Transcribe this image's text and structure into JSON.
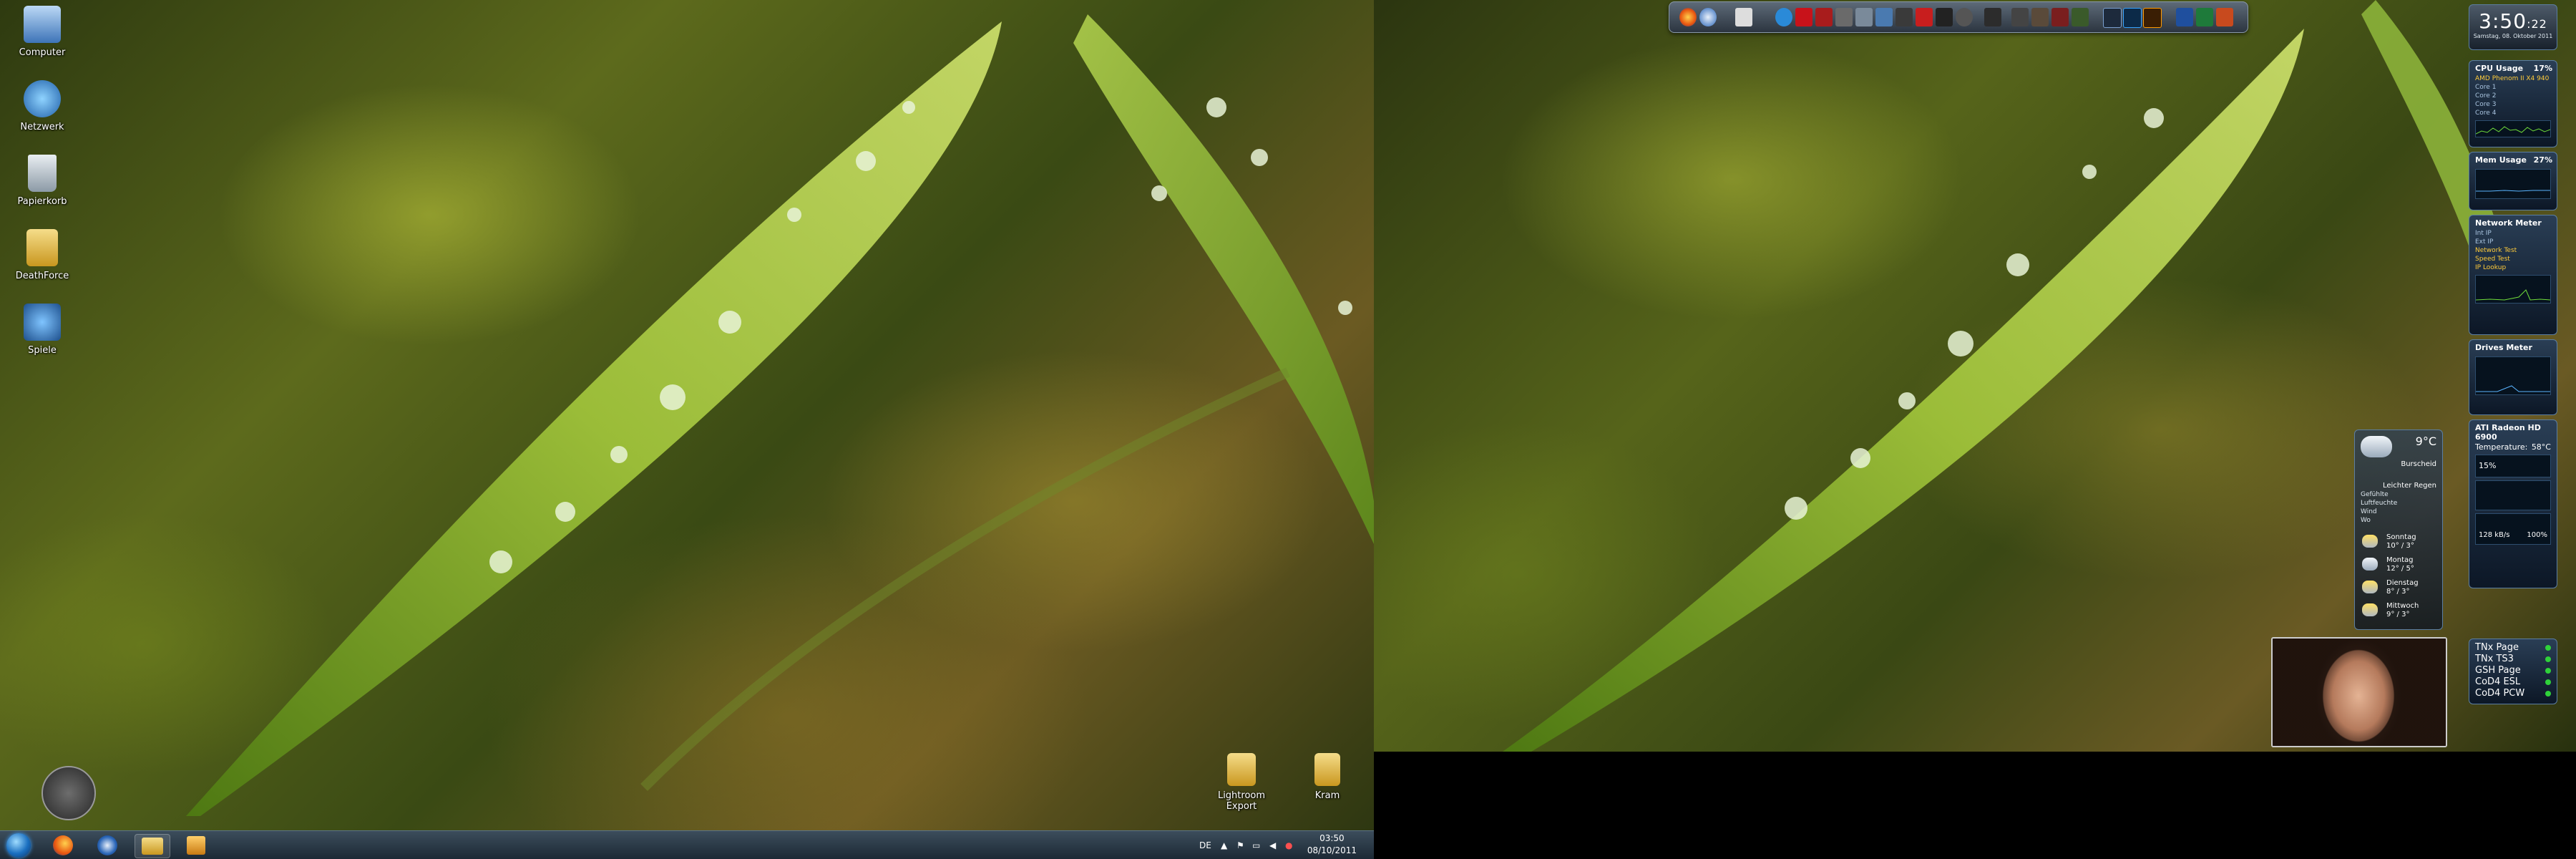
{
  "desktop_icons": [
    "Computer",
    "Netzwerk",
    "Papierkorb",
    "DeathForce",
    "Spiele"
  ],
  "desktop_folders": [
    "Lightroom Export",
    "Kram"
  ],
  "taskbar": {
    "language": "DE",
    "time": "03:50",
    "date": "08/10/2011",
    "pinned": [
      "firefox-icon",
      "thunderbird-icon",
      "explorer-icon",
      "media-player-icon"
    ]
  },
  "clock_gadget": {
    "time": "3:50",
    "seconds": ":22",
    "date": "Samstag, 08. Oktober 2011"
  },
  "cpu_gadget": {
    "title": "CPU Usage",
    "value": "17%",
    "rows": [
      "AMD Phenom II X4 940",
      "Core 1",
      "Core 2",
      "Core 3",
      "Core 4"
    ]
  },
  "mem_gadget": {
    "title": "Mem Usage",
    "value": "27%"
  },
  "net_gadget": {
    "title": "Network Meter",
    "rows": [
      "Int IP",
      "Ext IP",
      "Network Test",
      "Speed Test",
      "IP Lookup"
    ]
  },
  "drives_gadget": {
    "title": "Drives Meter"
  },
  "gpu_gadget": {
    "title": "ATI Radeon HD 6900",
    "temp_label": "Temperature:",
    "temp": "58°C",
    "percent": "15%"
  },
  "radio_gadget": {
    "bitrate": "128 kB/s",
    "volume": "100%"
  },
  "weather": {
    "temp": "9°C",
    "location": "Burscheid",
    "condition": "Leichter Regen",
    "rows": [
      "Gefühlte",
      "Luftfeuchte",
      "Wind",
      "Wo"
    ],
    "forecast": [
      {
        "day": "Sonntag",
        "range": "10° / 3°"
      },
      {
        "day": "Montag",
        "range": "12° / 5°"
      },
      {
        "day": "Dienstag",
        "range": "8° / 3°"
      },
      {
        "day": "Mittwoch",
        "range": "9° / 3°"
      }
    ]
  },
  "links": [
    "TNx Page",
    "TNx TS3",
    "GSH Page",
    "CoD4 ESL",
    "CoD4 PCW"
  ]
}
